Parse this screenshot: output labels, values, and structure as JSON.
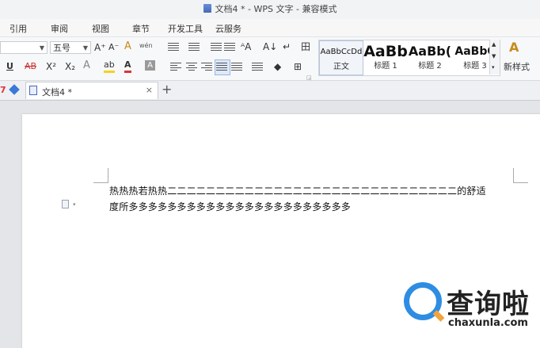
{
  "window": {
    "title": "文档4 * - WPS 文字 - 兼容模式"
  },
  "menu": {
    "tabs": [
      "引用",
      "审阅",
      "视图",
      "章节",
      "开发工具",
      "云服务"
    ]
  },
  "ribbon": {
    "font_size": "五号",
    "font_family": "",
    "grow_font": "A⁺",
    "shrink_font": "A⁻",
    "clear_format": "A",
    "pinyin": "wén",
    "underline": "U",
    "strikethrough": "AB",
    "superscript": "X²",
    "subscript": "X₂",
    "text_effect": "A",
    "highlight": "ab",
    "font_color": "A",
    "char_shading": "A",
    "styles": [
      {
        "preview": "AaBbCcDd",
        "name": "正文"
      },
      {
        "preview": "AaBb",
        "name": "标题 1"
      },
      {
        "preview": "AaBb(",
        "name": "标题 2"
      },
      {
        "preview": "AaBbC",
        "name": "标题 3"
      }
    ],
    "new_style": "新样式",
    "new_style_icon": "A"
  },
  "doc_tabs": {
    "active_tab": "文档4 *",
    "close": "×",
    "add": "+"
  },
  "document": {
    "line1": "热热热若热热二二二二二二二二二二二二二二二二二二二二二二二二二二二二二二的舒适",
    "line2": "度所多多多多多多多多多多多多多多多多多多多多多多多"
  },
  "watermark": {
    "name": "查询啦",
    "url": "chaxunla.com"
  },
  "colors": {
    "accent": "#2e8de3",
    "logo_orange": "#f2a33a",
    "highlight_yellow": "#f5d21e",
    "font_red": "#d33"
  }
}
